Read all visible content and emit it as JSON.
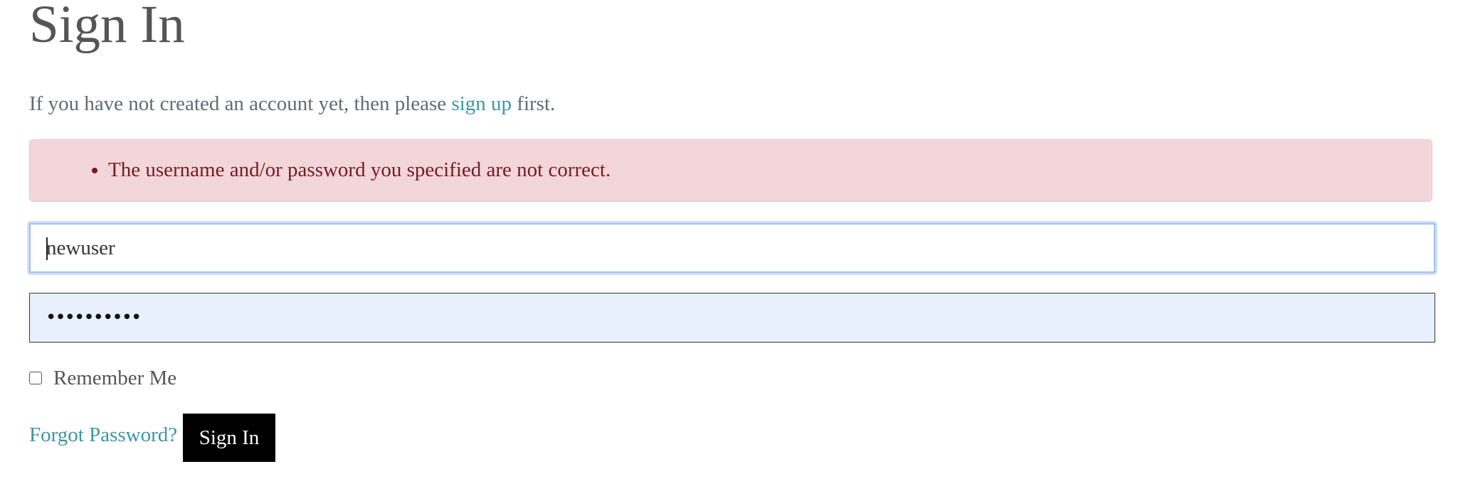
{
  "page": {
    "title": "Sign In"
  },
  "intro": {
    "before_link": "If you have not created an account yet, then please ",
    "link_text": "sign up",
    "after_link": " first."
  },
  "alert": {
    "errors": [
      "The username and/or password you specified are not correct."
    ]
  },
  "form": {
    "username_value": "newuser",
    "password_masked": "••••••••••",
    "remember_label": "Remember Me",
    "remember_checked": false,
    "forgot_label": "Forgot Password?",
    "submit_label": "Sign In"
  },
  "colors": {
    "link": "#3a97a6",
    "alert_bg": "#f3d6da",
    "alert_text": "#721c24",
    "button_bg": "#000000"
  }
}
